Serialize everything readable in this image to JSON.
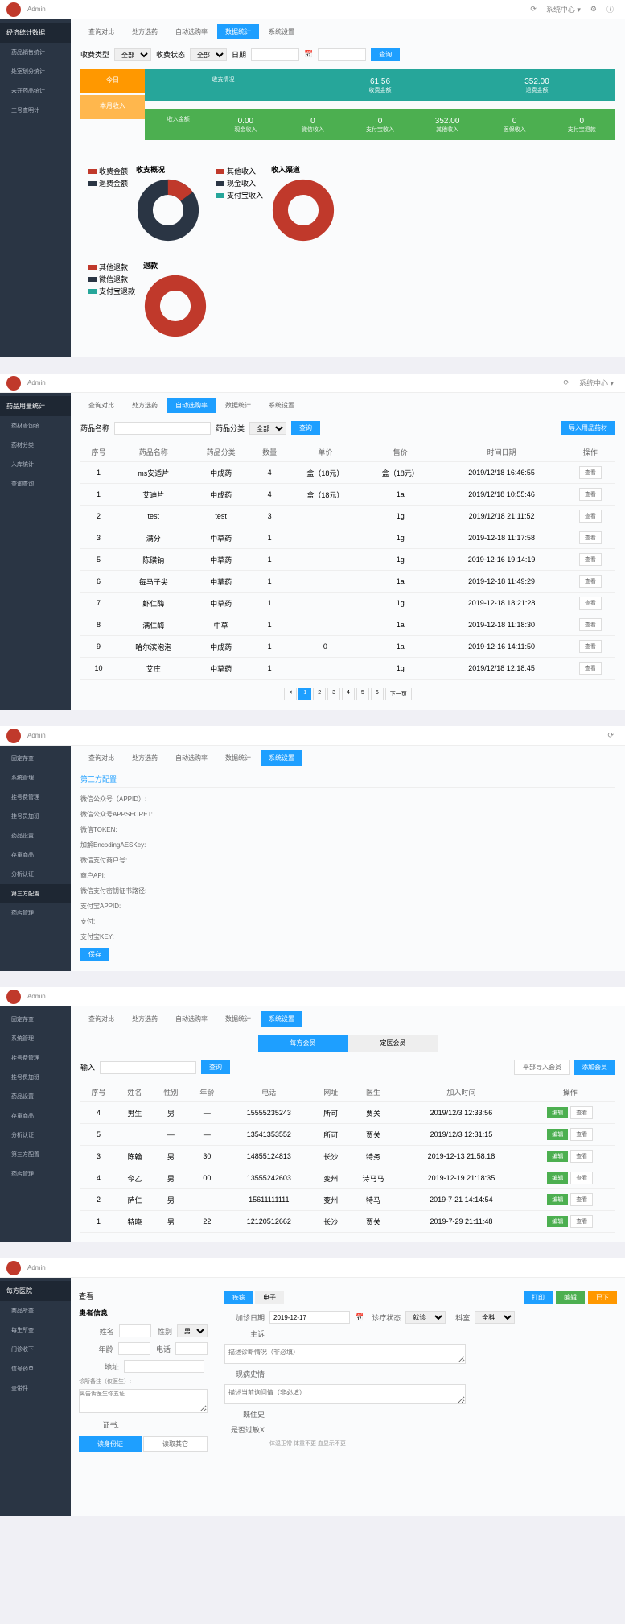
{
  "brand": "Admin",
  "topicons": [
    "⟳",
    "⊕",
    "↗",
    "⚙",
    "ⓘ"
  ],
  "nav_tabs": [
    "查询对比",
    "处方选药",
    "自动选购率",
    "数据统计",
    "系统设置"
  ],
  "panel1": {
    "sidebar_title": "经济统计数据",
    "sidebar": [
      {
        "l": "药品销售统计"
      },
      {
        "l": "处室划分统计"
      },
      {
        "l": "未开药品统计"
      },
      {
        "l": "工号查明计"
      }
    ],
    "filters": {
      "f1": "收费类型",
      "f2": "全部",
      "f3": "收费状态",
      "f4": "全部",
      "f5": "日期",
      "btn": "查询"
    },
    "left_cards": [
      {
        "l": "今日",
        "c": "orange"
      },
      {
        "l": "本月收入",
        "c": "orange"
      }
    ],
    "row1": {
      "title": "收支情况",
      "cells": [
        {
          "l": "61.56",
          "s": "收费金额"
        },
        {
          "l": "352.00",
          "s": "退费金额"
        }
      ]
    },
    "row2": {
      "title": "收入金额",
      "cells": [
        {
          "l": "0.00",
          "s": "现金收入"
        },
        {
          "l": "0",
          "s": "微信收入"
        },
        {
          "l": "0",
          "s": "支付宝收入"
        },
        {
          "l": "352.00",
          "s": "其他收入"
        },
        {
          "l": "0",
          "s": "医保收入"
        },
        {
          "l": "0",
          "s": "支付宝退款"
        }
      ]
    },
    "chart1": {
      "title": "收支概况",
      "legend": [
        {
          "n": "收费金额",
          "c": "#c0392b"
        },
        {
          "n": "退费金额",
          "c": "#2a3544"
        }
      ]
    },
    "chart2": {
      "title": "收入渠道",
      "legend": [
        {
          "n": "其他收入",
          "c": "#c0392b"
        },
        {
          "n": "现金收入",
          "c": "#2a3544"
        },
        {
          "n": "支付宝收入",
          "c": "#26a69a"
        }
      ]
    },
    "chart3": {
      "title": "退款",
      "legend": [
        {
          "n": "其他退款",
          "c": "#c0392b"
        },
        {
          "n": "微信退款",
          "c": "#2a3544"
        },
        {
          "n": "支付宝退款",
          "c": "#26a69a"
        }
      ]
    }
  },
  "panel2": {
    "sidebar_title": "药品用量统计",
    "sidebar": [
      {
        "l": "药材查询统"
      },
      {
        "l": "药材分类"
      },
      {
        "l": "入库统计"
      },
      {
        "l": "查询查询"
      }
    ],
    "filters": {
      "f1": "药品名称",
      "f2": "药品分类",
      "f3": "全部",
      "btn": "查询",
      "rbtn": "导入用品药材"
    },
    "cols": [
      "序号",
      "药品名称",
      "药品分类",
      "数量",
      "单价",
      "售价",
      "时间日期",
      "操作"
    ],
    "rows": [
      {
        "n": "1",
        "name": "ms安适片",
        "cat": "中成药",
        "qty": "4",
        "unit": "盒（18元）",
        "price": "盒（18元）",
        "date": "2019/12/18 16:46:55",
        "op": "查看"
      },
      {
        "n": "1",
        "name": "艾迪片",
        "cat": "中成药",
        "qty": "4",
        "unit": "盒（18元）",
        "price": "1a",
        "date": "2019/12/18 10:55:46",
        "op": "查看"
      },
      {
        "n": "2",
        "name": "test",
        "cat": "test",
        "qty": "3",
        "unit": "",
        "price": "1g",
        "date": "2019/12/18 21:11:52",
        "op": "查看"
      },
      {
        "n": "3",
        "name": "满分",
        "cat": "中草药",
        "qty": "1",
        "unit": "",
        "price": "1g",
        "date": "2019-12-18 11:17:58",
        "op": "查看"
      },
      {
        "n": "5",
        "name": "陈磺钠",
        "cat": "中草药",
        "qty": "1",
        "unit": "",
        "price": "1g",
        "date": "2019-12-16 19:14:19",
        "op": "查看"
      },
      {
        "n": "6",
        "name": "每马子尖",
        "cat": "中草药",
        "qty": "1",
        "unit": "",
        "price": "1a",
        "date": "2019-12-18 11:49:29",
        "op": "查看"
      },
      {
        "n": "7",
        "name": "虾仁酶",
        "cat": "中草药",
        "qty": "1",
        "unit": "",
        "price": "1g",
        "date": "2019-12-18 18:21:28",
        "op": "查看"
      },
      {
        "n": "8",
        "name": "满仁酶",
        "cat": "中草",
        "qty": "1",
        "unit": "",
        "price": "1a",
        "date": "2019-12-18 11:18:30",
        "op": "查看"
      },
      {
        "n": "9",
        "name": "哈尔滨泡泡",
        "cat": "中成药",
        "qty": "1",
        "unit": "0",
        "price": "1a",
        "date": "2019-12-16 14:11:50",
        "op": "查看"
      },
      {
        "n": "10",
        "name": "艾庄",
        "cat": "中草药",
        "qty": "1",
        "unit": "",
        "price": "1g",
        "date": "2019/12/18 12:18:45",
        "op": "查看"
      }
    ],
    "pages": [
      "<",
      "1",
      "2",
      "3",
      "4",
      "5",
      "6",
      "下一页"
    ]
  },
  "panel3": {
    "sidebar": [
      {
        "l": "固定存查"
      },
      {
        "l": "系统管理"
      },
      {
        "l": "挂号费管理"
      },
      {
        "l": "挂号员加班"
      },
      {
        "l": "药品设置"
      },
      {
        "l": "存童商品"
      },
      {
        "l": "分析认证"
      },
      {
        "l": "第三方配置",
        "active": true
      },
      {
        "l": "药店管理"
      }
    ],
    "title": "第三方配置",
    "rows": [
      "微信公众号（APPID）:",
      "微信公众号APPSECRET:",
      "微信TOKEN:",
      "加解EncodingAESKey:",
      "微信支付商户号:",
      "商户API:",
      "微信支付密钥证书路径:",
      "支付宝APPID:",
      "支付:",
      "支付宝KEY:"
    ],
    "btn": "保存"
  },
  "panel4": {
    "sidebar": [
      {
        "l": "固定存查"
      },
      {
        "l": "系统管理"
      },
      {
        "l": "挂号费管理"
      },
      {
        "l": "挂号员加班"
      },
      {
        "l": "药品设置"
      },
      {
        "l": "存童商品"
      },
      {
        "l": "分析认证"
      },
      {
        "l": "第三方配置"
      },
      {
        "l": "药店管理"
      }
    ],
    "subtabs": [
      {
        "l": "每方会员",
        "active": true
      },
      {
        "l": "定医会员"
      }
    ],
    "filters": {
      "f1": "输入",
      "btn": "查询"
    },
    "rbtns": [
      {
        "l": "平部导入会员",
        "c": "outline"
      },
      {
        "l": "添加会员",
        "c": ""
      }
    ],
    "cols": [
      "序号",
      "姓名",
      "性别",
      "年龄",
      "电话",
      "网址",
      "医生",
      "加入时间",
      "操作"
    ],
    "rows": [
      {
        "n": "4",
        "name": "男生",
        "sex": "男",
        "age": "—",
        "tel": "15555235243",
        "site": "所可",
        "doc": "贾关",
        "date": "2019/12/3 12:33:56",
        "op1": "编辑",
        "op2": "查看"
      },
      {
        "n": "5",
        "name": "",
        "sex": "—",
        "age": "—",
        "tel": "13541353552",
        "site": "所可",
        "doc": "贾关",
        "date": "2019/12/3 12:31:15",
        "op1": "编辑",
        "op2": "查看"
      },
      {
        "n": "3",
        "name": "陈翰",
        "sex": "男",
        "age": "30",
        "tel": "14855124813",
        "site": "长沙",
        "doc": "特务",
        "date": "2019-12-13 21:58:18",
        "op1": "编辑",
        "op2": "查看"
      },
      {
        "n": "4",
        "name": "今乙",
        "sex": "男",
        "age": "00",
        "tel": "13555242603",
        "site": "变州",
        "doc": "诗马马",
        "date": "2019-12-19 21:18:35",
        "op1": "编辑",
        "op2": "查看"
      },
      {
        "n": "2",
        "name": "萨仁",
        "sex": "男",
        "age": "",
        "tel": "15611111111",
        "site": "变州",
        "doc": "特马",
        "date": "2019-7-21 14:14:54",
        "op1": "编辑",
        "op2": "查看"
      },
      {
        "n": "1",
        "name": "特晓",
        "sex": "男",
        "age": "22",
        "tel": "12120512662",
        "site": "长沙",
        "doc": "贾关",
        "date": "2019-7-29 21:11:48",
        "op1": "编辑",
        "op2": "查看"
      }
    ]
  },
  "panel5": {
    "sidebar_title": "每方医院",
    "sidebar": [
      {
        "l": "商品所查"
      },
      {
        "l": "每生所查"
      },
      {
        "l": "门诊收下"
      },
      {
        "l": "信号药单"
      },
      {
        "l": "查带件"
      }
    ],
    "title": "查看",
    "rbtns": [
      {
        "l": "打印",
        "c": ""
      },
      {
        "l": "编辑",
        "c": "green"
      },
      {
        "l": "已下",
        "c": "orange"
      }
    ],
    "left_title": "患者信息",
    "lrows": [
      {
        "l": "姓名",
        "v": "",
        "l2": "性别",
        "v2": "男"
      },
      {
        "l": "年龄",
        "v": "",
        "l2": "电话",
        "v2": ""
      },
      {
        "l": "地址",
        "v": ""
      }
    ],
    "note_label": "诊所备注（仅医生）:",
    "note_ph": "离告诉医生你五证",
    "cert_label": "证书:",
    "lbtns": [
      {
        "l": "读身份证",
        "active": true
      },
      {
        "l": "读取其它"
      }
    ],
    "minitabs": [
      {
        "l": "疾病",
        "active": true
      },
      {
        "l": "电子"
      }
    ],
    "rrows": [
      {
        "l": "加诊日期",
        "v": "2019-12-17",
        "l2": "诊疗状态",
        "v2": "就诊",
        "l3": "科室",
        "v3": "全科"
      },
      {
        "l": "主诉"
      },
      {
        "ph": "描述诊断情况（非必填）"
      },
      {
        "l": "现病史情"
      },
      {
        "ph": "描述当前询问情（非必填）"
      },
      {
        "l": "既住史"
      },
      {
        "l": "是否过敏X"
      },
      {
        "l": "体温正常 体重不更 血显示不更",
        "sub": true
      }
    ]
  },
  "chart_data": [
    {
      "type": "pie",
      "title": "收支概况",
      "series": [
        {
          "name": "收费金额",
          "value": 61.56,
          "color": "#c0392b"
        },
        {
          "name": "退费金额",
          "value": 352.0,
          "color": "#2a3544"
        }
      ]
    },
    {
      "type": "pie",
      "title": "收入渠道",
      "series": [
        {
          "name": "其他收入",
          "value": 352.0,
          "color": "#c0392b"
        },
        {
          "name": "现金收入",
          "value": 0,
          "color": "#2a3544"
        },
        {
          "name": "支付宝收入",
          "value": 0,
          "color": "#26a69a"
        }
      ]
    },
    {
      "type": "pie",
      "title": "退款",
      "series": [
        {
          "name": "其他退款",
          "value": 100,
          "color": "#c0392b"
        },
        {
          "name": "微信退款",
          "value": 0,
          "color": "#2a3544"
        },
        {
          "name": "支付宝退款",
          "value": 0,
          "color": "#26a69a"
        }
      ]
    }
  ]
}
